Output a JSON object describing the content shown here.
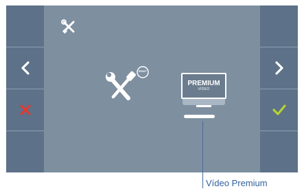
{
  "header": {
    "icon": "tools-icon"
  },
  "left_buttons": [
    {
      "icon": "none"
    },
    {
      "icon": "chevron-left-icon"
    },
    {
      "icon": "close-icon",
      "color": "#e8362f"
    },
    {
      "icon": "none"
    }
  ],
  "right_buttons": [
    {
      "icon": "none"
    },
    {
      "icon": "chevron-right-icon"
    },
    {
      "icon": "check-icon",
      "color": "#b5d334"
    },
    {
      "icon": "none"
    }
  ],
  "menu": {
    "items": [
      {
        "name": "tools-reset",
        "icon": "tools-reset-icon",
        "badge": "RESET"
      },
      {
        "name": "premium-video",
        "icon": "monitor-icon",
        "title": "PREMIUM",
        "subtitle": "VIDEO",
        "selected": true
      }
    ]
  },
  "callout": {
    "label": "Vídeo Premium"
  },
  "colors": {
    "screen_bg": "#7e8fa0",
    "side_bg": "#5d7188",
    "callout": "#2f5f9e"
  }
}
